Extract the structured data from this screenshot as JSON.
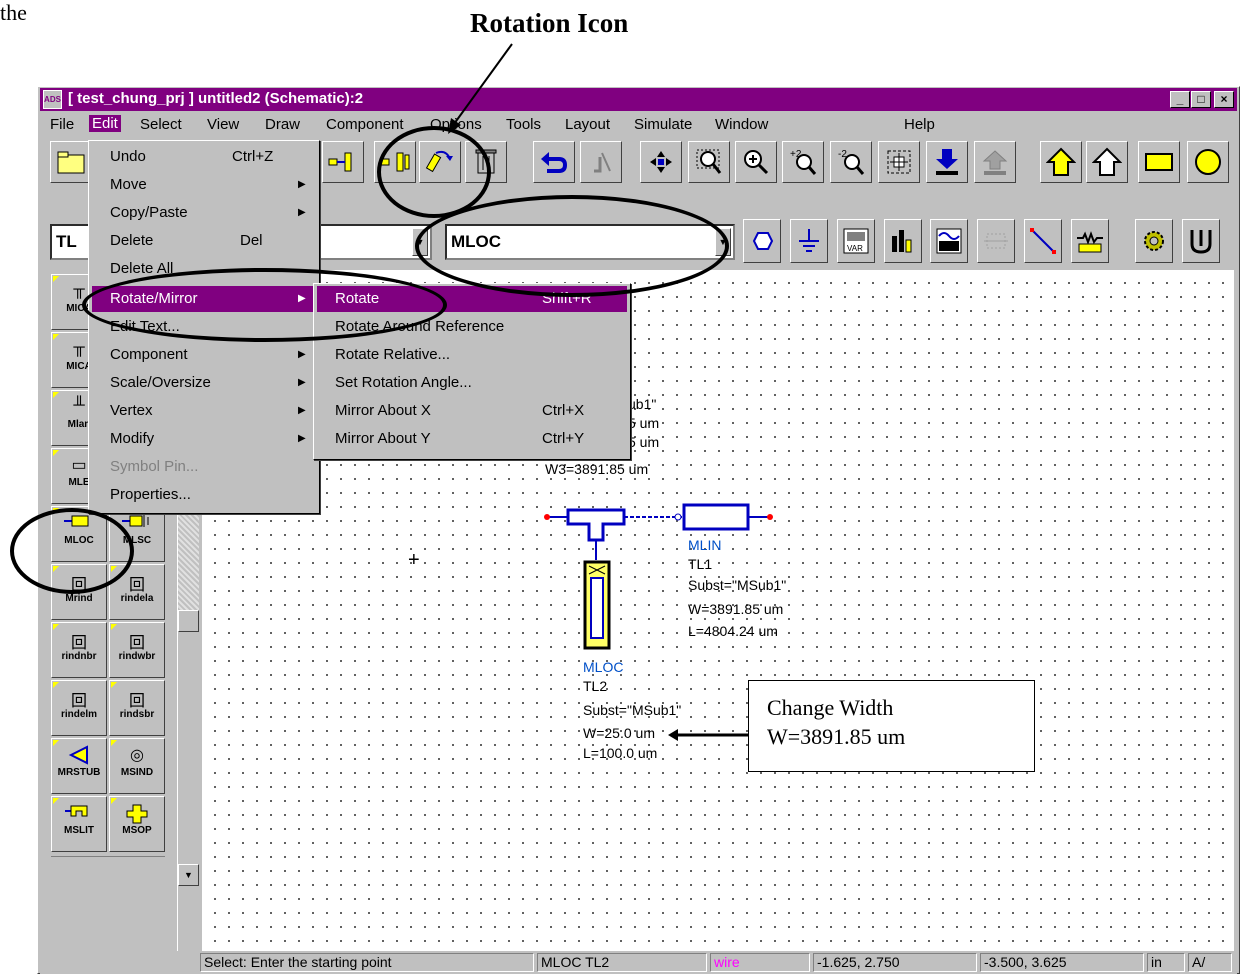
{
  "header_text": "the ",
  "annotation_title": "Rotation Icon",
  "window": {
    "title": "[ test_chung_prj ] untitled2 (Schematic):2",
    "icon_label": "ADS",
    "minimize": "_",
    "maximize": "□",
    "close": "×"
  },
  "menubar": [
    "File",
    "Edit",
    "Select",
    "View",
    "Draw",
    "Component",
    "Options",
    "Tools",
    "Layout",
    "Simulate",
    "Window",
    "Help"
  ],
  "toolbar2": {
    "left_combo": "TL",
    "component_combo": "MLOC"
  },
  "edit_menu": [
    {
      "label": "Undo",
      "shortcut": "Ctrl+Z"
    },
    {
      "label": "Move",
      "submenu": true
    },
    {
      "label": "Copy/Paste",
      "submenu": true
    },
    {
      "label": "Delete",
      "shortcut": "Del"
    },
    {
      "label": "Delete All"
    },
    {
      "label": "Rotate/Mirror",
      "submenu": true,
      "highlighted": true
    },
    {
      "label": "Edit Text..."
    },
    {
      "label": "Component",
      "submenu": true
    },
    {
      "label": "Scale/Oversize",
      "submenu": true
    },
    {
      "label": "Vertex",
      "submenu": true
    },
    {
      "label": "Modify",
      "submenu": true
    },
    {
      "label": "Symbol Pin...",
      "disabled": true
    },
    {
      "label": "Properties..."
    }
  ],
  "rotate_menu": [
    {
      "label": "Rotate",
      "shortcut": "Shift+R",
      "highlighted": true
    },
    {
      "label": "Rotate Around Reference"
    },
    {
      "label": "Rotate Relative..."
    },
    {
      "label": "Set Rotation Angle..."
    },
    {
      "label": "Mirror About X",
      "shortcut": "Ctrl+X"
    },
    {
      "label": "Mirror About Y",
      "shortcut": "Ctrl+Y"
    }
  ],
  "palette": [
    {
      "label": "MICA"
    },
    {
      "label": "MICA"
    },
    {
      "label": "Mlan"
    },
    {
      "label": "MLE"
    },
    {
      "label": "MLOC"
    },
    {
      "label": "MLSC"
    },
    {
      "label": "Mrind"
    },
    {
      "label": "rindela"
    },
    {
      "label": "rindnbr"
    },
    {
      "label": "rindwbr"
    },
    {
      "label": "rindelm"
    },
    {
      "label": "rindsbr"
    },
    {
      "label": "MRSTUB"
    },
    {
      "label": "MSIND"
    },
    {
      "label": "MSLIT"
    },
    {
      "label": "MSOP"
    }
  ],
  "schematic": {
    "tee_params": [
      "ub1\"",
      "5 um",
      "5 um",
      "W3=3891.85 um"
    ],
    "mlin": {
      "type": "MLIN",
      "name": "TL1",
      "subst": "Subst=\"MSub1\"",
      "w": "W=3891.85 um",
      "l": "L=4804.24 um"
    },
    "mloc": {
      "type": "MLOC",
      "name": "TL2",
      "subst": "Subst=\"MSub1\"",
      "w": "W=25.0 um",
      "l": "L=100.0 um"
    }
  },
  "callout": {
    "line1": "Change Width",
    "line2": "W=3891.85 um"
  },
  "statusbar": {
    "prompt": "Select: Enter the starting point",
    "selection": "MLOC TL2",
    "mode": "wire",
    "coord1": "-1.625, 2.750",
    "coord2": "-3.500, 3.625",
    "unit": "in",
    "extra": "A/"
  },
  "colors": {
    "title_bar": "#800080",
    "menu_highlight": "#800080",
    "component_blue": "#0000c0",
    "wire_mode": "#ff00ff",
    "component_fill": "#ffff66"
  }
}
